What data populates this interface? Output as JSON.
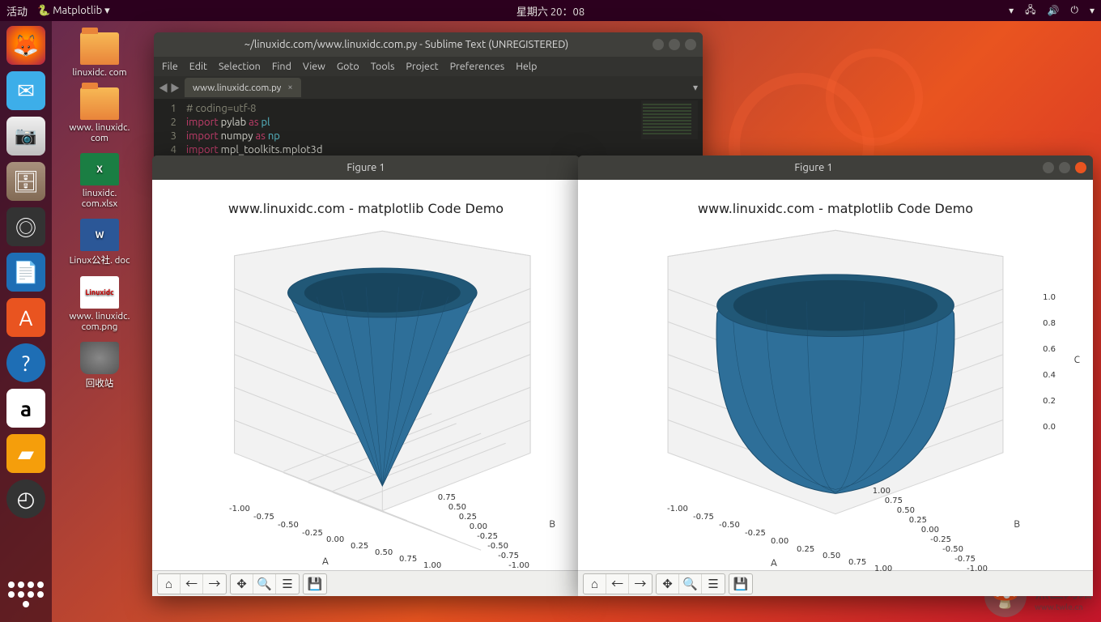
{
  "topbar": {
    "activities": "活动",
    "app_name": "Matplotlib",
    "clock": "星期六 20：08"
  },
  "desktop_icons": [
    {
      "label": "linuxidc. com",
      "type": "folder"
    },
    {
      "label": "www. linuxidc. com",
      "type": "folder"
    },
    {
      "label": "linuxidc. com.xlsx",
      "type": "xls",
      "glyph": "X"
    },
    {
      "label": "Linux公社. doc",
      "type": "doc",
      "glyph": "W"
    },
    {
      "label": "www. linuxidc. com.png",
      "type": "png",
      "glyph": "Linuxidc"
    },
    {
      "label": "回收站",
      "type": "trash"
    }
  ],
  "sublime": {
    "title": "~/linuxidc.com/www.linuxidc.com.py - Sublime Text (UNREGISTERED)",
    "menus": [
      "File",
      "Edit",
      "Selection",
      "Find",
      "View",
      "Goto",
      "Tools",
      "Project",
      "Preferences",
      "Help"
    ],
    "tab_name": "www.linuxidc.com.py",
    "lines": [
      {
        "n": "1",
        "raw": "# coding=utf-8"
      },
      {
        "n": "2",
        "raw": "import pylab as pl"
      },
      {
        "n": "3",
        "raw": "import numpy as np"
      },
      {
        "n": "4",
        "raw": "import mpl_toolkits.mplot3d"
      }
    ]
  },
  "figure_left": {
    "title": "Figure 1",
    "plot_title": "www.linuxidc.com - matplotlib Code Demo"
  },
  "figure_right": {
    "title": "Figure 1",
    "plot_title": "www.linuxidc.com - matplotlib Code Demo"
  },
  "axis": {
    "a_label": "A",
    "b_label": "B",
    "c_label": "C",
    "ticks_ab": [
      "-1.00",
      "-0.75",
      "-0.50",
      "-0.25",
      "0.00",
      "0.25",
      "0.50",
      "0.75",
      "1.00"
    ],
    "ticks_c": [
      "0.0",
      "0.2",
      "0.4",
      "0.6",
      "0.8",
      "1.0"
    ]
  },
  "chart_data": [
    {
      "type": "3d-surface",
      "title": "www.linuxidc.com - matplotlib Code Demo",
      "xlabel": "A",
      "ylabel": "B",
      "zlabel": "C",
      "xlim": [
        -1.0,
        1.0
      ],
      "ylim": [
        -1.0,
        1.0
      ],
      "zlim": [
        0.0,
        1.0
      ],
      "xticks": [
        -1.0,
        -0.75,
        -0.5,
        -0.25,
        0.0,
        0.25,
        0.5,
        0.75,
        1.0
      ],
      "yticks": [
        -1.0,
        -0.75,
        -0.5,
        -0.25,
        0.0,
        0.25,
        0.5,
        0.75,
        1.0
      ],
      "zticks": [
        0.0,
        0.2,
        0.4,
        0.6,
        0.8,
        1.0
      ],
      "surface": "cone: r = z, z in [0,1], theta in [0,2pi]",
      "color": "#2e6f99"
    },
    {
      "type": "3d-surface",
      "title": "www.linuxidc.com - matplotlib Code Demo",
      "xlabel": "A",
      "ylabel": "B",
      "zlabel": "C",
      "xlim": [
        -1.0,
        1.0
      ],
      "ylim": [
        -1.0,
        1.0
      ],
      "zlim": [
        0.0,
        1.0
      ],
      "xticks": [
        -1.0,
        -0.75,
        -0.5,
        -0.25,
        0.0,
        0.25,
        0.5,
        0.75,
        1.0
      ],
      "yticks": [
        -1.0,
        -0.75,
        -0.5,
        -0.25,
        0.0,
        0.25,
        0.5,
        0.75,
        1.0
      ],
      "zticks": [
        0.0,
        0.2,
        0.4,
        0.6,
        0.8,
        1.0
      ],
      "surface": "paraboloid bowl: r = sqrt(z), z in [0,1], theta in [0,2pi]",
      "color": "#2e6f99"
    }
  ],
  "watermark": {
    "text": "黑区网络",
    "sub": "www.twle.cn"
  }
}
